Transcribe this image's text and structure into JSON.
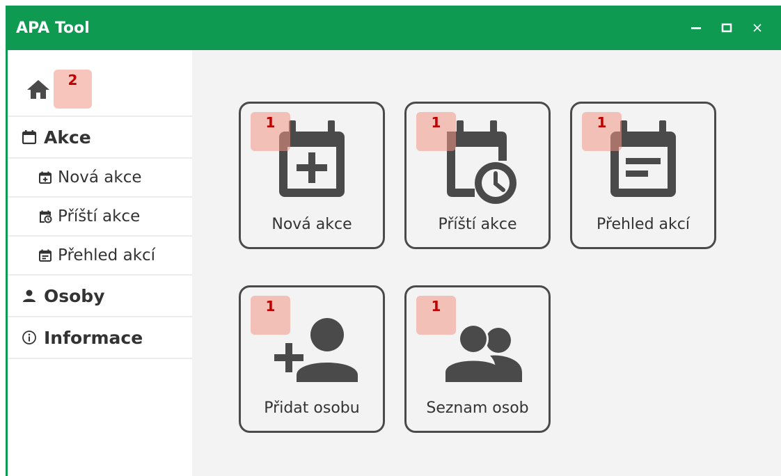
{
  "window": {
    "title": "APA Tool",
    "accent_color": "#0f9a52",
    "controls": [
      "minimize-icon",
      "maximize-icon",
      "close-icon"
    ]
  },
  "sidebar": {
    "home": {
      "icon": "home-icon",
      "badge": "2"
    },
    "sections": [
      {
        "label": "Akce",
        "icon": "calendar-icon"
      },
      {
        "label": "Osoby",
        "icon": "person-icon"
      },
      {
        "label": "Informace",
        "icon": "info-icon"
      }
    ],
    "akce_items": [
      {
        "label": "Nová akce",
        "icon": "calendar-plus-icon"
      },
      {
        "label": "Příští akce",
        "icon": "calendar-clock-icon"
      },
      {
        "label": "Přehled akcí",
        "icon": "calendar-list-icon"
      }
    ]
  },
  "tiles": [
    {
      "label": "Nová akce",
      "icon": "calendar-plus-icon",
      "badge": "1"
    },
    {
      "label": "Příští akce",
      "icon": "calendar-clock-icon",
      "badge": "1"
    },
    {
      "label": "Přehled akcí",
      "icon": "calendar-list-icon",
      "badge": "1"
    },
    {
      "label": "Přidat osobu",
      "icon": "person-add-icon",
      "badge": "1"
    },
    {
      "label": "Seznam osob",
      "icon": "people-icon",
      "badge": "1"
    }
  ],
  "colors": {
    "icon": "#4a4a4a",
    "badge_bg": "#f39687",
    "badge_text": "#c00000"
  }
}
